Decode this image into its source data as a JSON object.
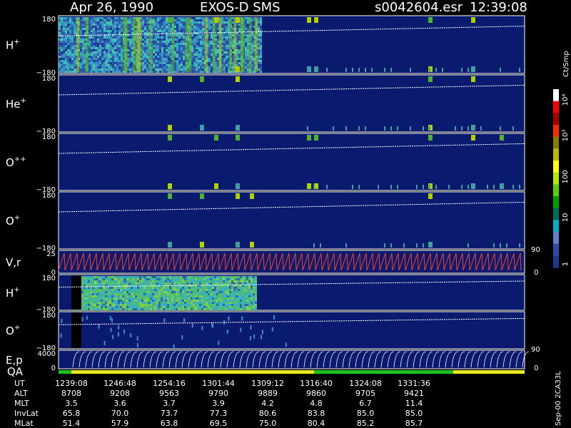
{
  "header": {
    "date": "Apr 26, 1990",
    "mission": "EXOS-D SMS",
    "file": "s0042604.esr",
    "time": "12:39:08"
  },
  "panels": [
    {
      "label": "H",
      "sup": "+",
      "top": "180",
      "bottom": "−180"
    },
    {
      "label": "He",
      "sup": "+",
      "top": "180",
      "bottom": "−180"
    },
    {
      "label": "O",
      "sup": "++",
      "top": "180",
      "bottom": "−180"
    },
    {
      "label": "O",
      "sup": "+",
      "top": "180",
      "bottom": "−180"
    },
    {
      "label": "V,r",
      "sup": "",
      "top": "25",
      "bottom": "0"
    },
    {
      "label": "H",
      "sup": "+",
      "top": "180",
      "bottom": "−180"
    },
    {
      "label": "O",
      "sup": "+",
      "top": "180",
      "bottom": "−180"
    },
    {
      "label": "E,p",
      "sup": "",
      "top": "4000",
      "bottom": "0"
    }
  ],
  "qa_label": "QA",
  "right_axes": {
    "vr": {
      "top": "90",
      "bottom": "0"
    },
    "ep": {
      "top": "90",
      "bottom": "0"
    }
  },
  "colorbar": {
    "title": "Ct/Smp",
    "labels": [
      "10⁴",
      "10³",
      "100",
      "10",
      "1"
    ],
    "colors": [
      "#ffffff",
      "#ff0000",
      "#a60000",
      "#ff2a00",
      "#8b7a00",
      "#b8b800",
      "#ffff00",
      "#b4e800",
      "#55d000",
      "#00a000",
      "#006a60",
      "#00b0c8",
      "#5a82c8",
      "#2a4ea8",
      "#1a3a90"
    ]
  },
  "footer": {
    "stamp": "Sep-00 2CA33L",
    "rows": [
      {
        "name": "UT",
        "values": [
          "1239:08",
          "1246:48",
          "1254:16",
          "1301:44",
          "1309:12",
          "1316:40",
          "1324:08",
          "1331:36"
        ]
      },
      {
        "name": "ALT",
        "values": [
          "8708",
          "9208",
          "9563",
          "9790",
          "9889",
          "9860",
          "9705",
          "9421"
        ]
      },
      {
        "name": "MLT",
        "values": [
          "3.5",
          "3.6",
          "3.7",
          "3.9",
          "4.2",
          "4.8",
          "6.7",
          "11.4"
        ]
      },
      {
        "name": "InvLat",
        "values": [
          "65.8",
          "70.0",
          "73.7",
          "77.3",
          "80.6",
          "83.8",
          "85.0",
          "85.0"
        ]
      },
      {
        "name": "MLat",
        "values": [
          "51.4",
          "57.9",
          "63.8",
          "69.5",
          "75.0",
          "80.4",
          "85.2",
          "85.7"
        ]
      }
    ]
  },
  "colors": {
    "background": "#0a1a6e",
    "line": "#ffffff",
    "vr_trace": "#ff4020",
    "qa_yellow": "#e8e820",
    "qa_green": "#20c020"
  }
}
